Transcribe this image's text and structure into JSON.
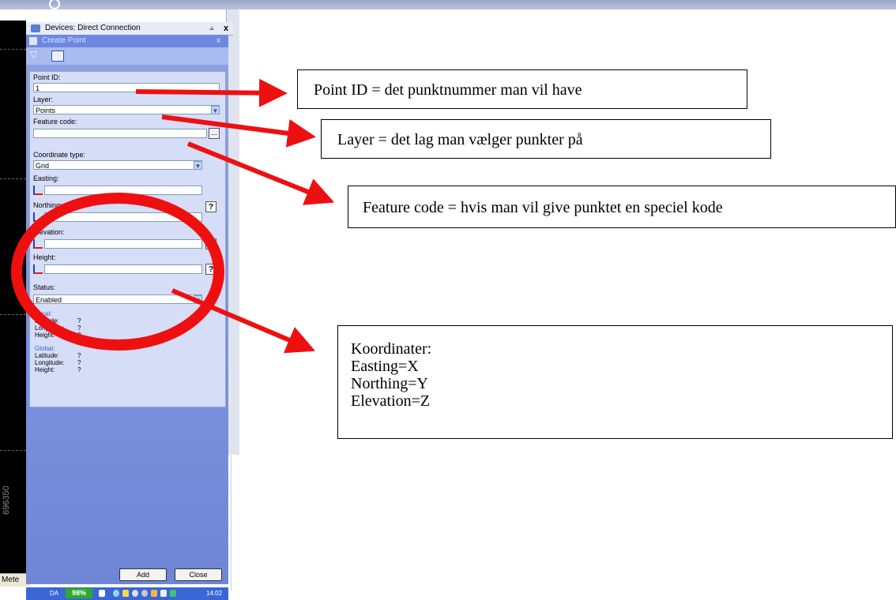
{
  "devices_panel": {
    "title": "Devices: Direct Connection",
    "pin_icon": "pin-icon",
    "close_label": "x"
  },
  "left_app": {
    "close_label": "x",
    "coordinate_readout": "696350",
    "status_label": "Mete"
  },
  "create_point": {
    "title": "Create Point",
    "close_label": "x",
    "fields": {
      "point_id": {
        "label": "Point ID:",
        "value": "1"
      },
      "layer": {
        "label": "Layer:",
        "value": "Points"
      },
      "feature_code": {
        "label": "Feature code:",
        "value": "",
        "button": "..."
      },
      "coordinate_type": {
        "label": "Coordinate type:",
        "value": "Grid"
      },
      "easting": {
        "label": "Easting:",
        "value": ""
      },
      "northing": {
        "label": "Northing:",
        "value": "",
        "help": "?"
      },
      "elevation": {
        "label": "Elevation:",
        "value": "",
        "help": "?"
      },
      "height": {
        "label": "Height:",
        "value": "",
        "help": "?"
      },
      "status": {
        "label": "Status:",
        "value": "Enabled"
      }
    },
    "local": {
      "heading": "Local:",
      "rows": [
        {
          "label": "Latitude:",
          "value": "?"
        },
        {
          "label": "Longitude:",
          "value": "?"
        },
        {
          "label": "Height:",
          "value": "?"
        }
      ]
    },
    "global": {
      "heading": "Global:",
      "rows": [
        {
          "label": "Latitude:",
          "value": "?"
        },
        {
          "label": "Longitude:",
          "value": "?"
        },
        {
          "label": "Height:",
          "value": "?"
        }
      ]
    },
    "buttons": {
      "add": "Add",
      "close": "Close"
    }
  },
  "taskbar": {
    "language": "DA",
    "battery": "98%",
    "time": "14:02"
  },
  "callouts": {
    "point_id": "Point ID = det punktnummer man vil have",
    "layer": "Layer = det lag man vælger punkter på",
    "feature_code": "Feature code = hvis man vil give punktet en speciel kode",
    "koordinater": [
      "Koordinater:",
      "Easting=X",
      "Northing=Y",
      "Elevation=Z"
    ]
  },
  "colors": {
    "annotation_red": "#ee1010",
    "panel_blue": "#7b92dc",
    "accent_text_blue": "#2b63d8"
  }
}
